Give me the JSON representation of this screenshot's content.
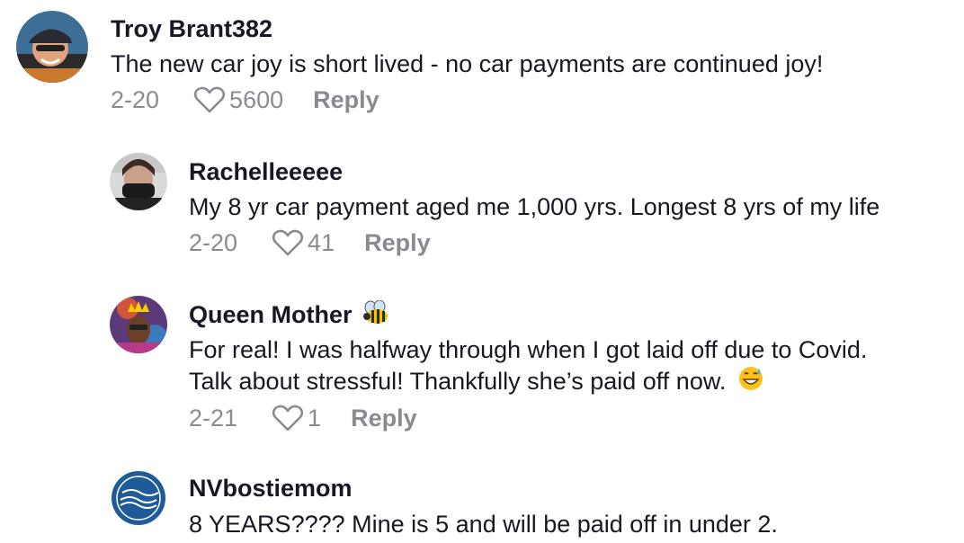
{
  "comments": [
    {
      "username": "Troy Brant382",
      "text_lines": [
        "The new car joy is short lived - no car payments are continued joy!"
      ],
      "date": "2-20",
      "likes": "5600",
      "reply_label": "Reply",
      "avatar_icon": "user-photo-avatar"
    },
    {
      "username": "Rachelleeeee",
      "text_lines": [
        "My 8 yr car payment aged me 1,000 yrs. Longest 8 yrs of my life"
      ],
      "date": "2-20",
      "likes": "41",
      "reply_label": "Reply",
      "avatar_icon": "user-photo-avatar"
    },
    {
      "username": "Queen Mother",
      "username_emoji": "bee-emoji",
      "text_lines": [
        "For real! I was halfway through when I got laid off due to Covid.",
        "Talk about stressful! Thankfully she’s paid off now."
      ],
      "text_emoji": "grinning-sweat-emoji",
      "date": "2-21",
      "likes": "1",
      "reply_label": "Reply",
      "avatar_icon": "user-photo-avatar"
    },
    {
      "username": "NVbostiemom",
      "text_lines": [
        "8 YEARS???? Mine is 5 and will be paid off in under 2."
      ],
      "avatar_icon": "stay-dutch-logo-avatar"
    }
  ],
  "colors": {
    "username": "#161823",
    "body_text": "#161823",
    "meta_text": "#8a8b91"
  }
}
